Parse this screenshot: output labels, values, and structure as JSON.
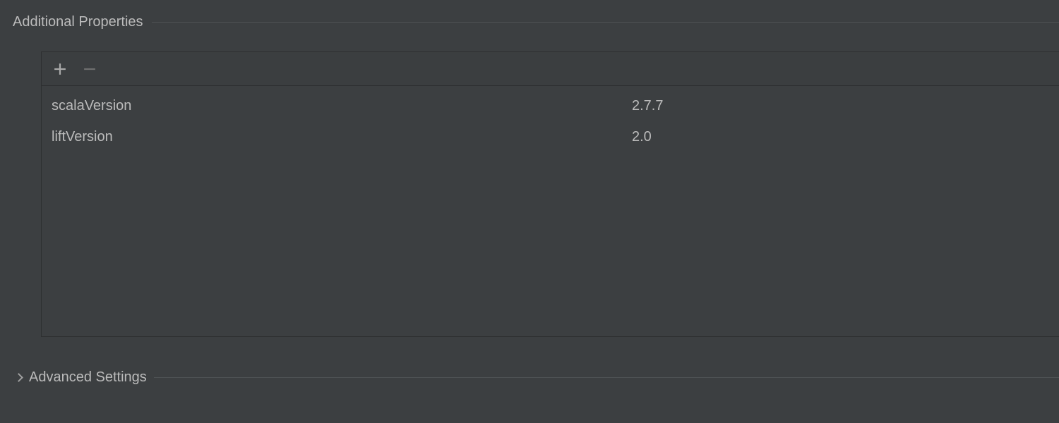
{
  "sections": {
    "additional_properties": {
      "title": "Additional Properties"
    },
    "advanced_settings": {
      "title": "Advanced Settings"
    }
  },
  "properties": {
    "rows": [
      {
        "key": "scalaVersion",
        "value": "2.7.7"
      },
      {
        "key": "liftVersion",
        "value": "2.0"
      }
    ]
  },
  "colors": {
    "background": "#3c3f41",
    "border": "#2d2f30",
    "text": "#bbbbbb"
  }
}
